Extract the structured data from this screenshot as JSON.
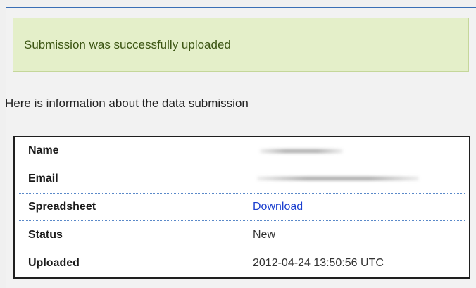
{
  "message": {
    "success_text": "Submission was successfully uploaded"
  },
  "intro_text": "Here is information about the data submission",
  "details": {
    "rows": [
      {
        "label": "Name",
        "value": ""
      },
      {
        "label": "Email",
        "value": ""
      },
      {
        "label": "Spreadsheet",
        "value": "Download"
      },
      {
        "label": "Status",
        "value": "New"
      },
      {
        "label": "Uploaded",
        "value": "2012-04-24 13:50:56 UTC"
      }
    ]
  },
  "colors": {
    "success_background": "#e4efc9",
    "success_border": "#c5d79a",
    "link": "#1b3fcf",
    "row_separator": "#5a89c9"
  }
}
